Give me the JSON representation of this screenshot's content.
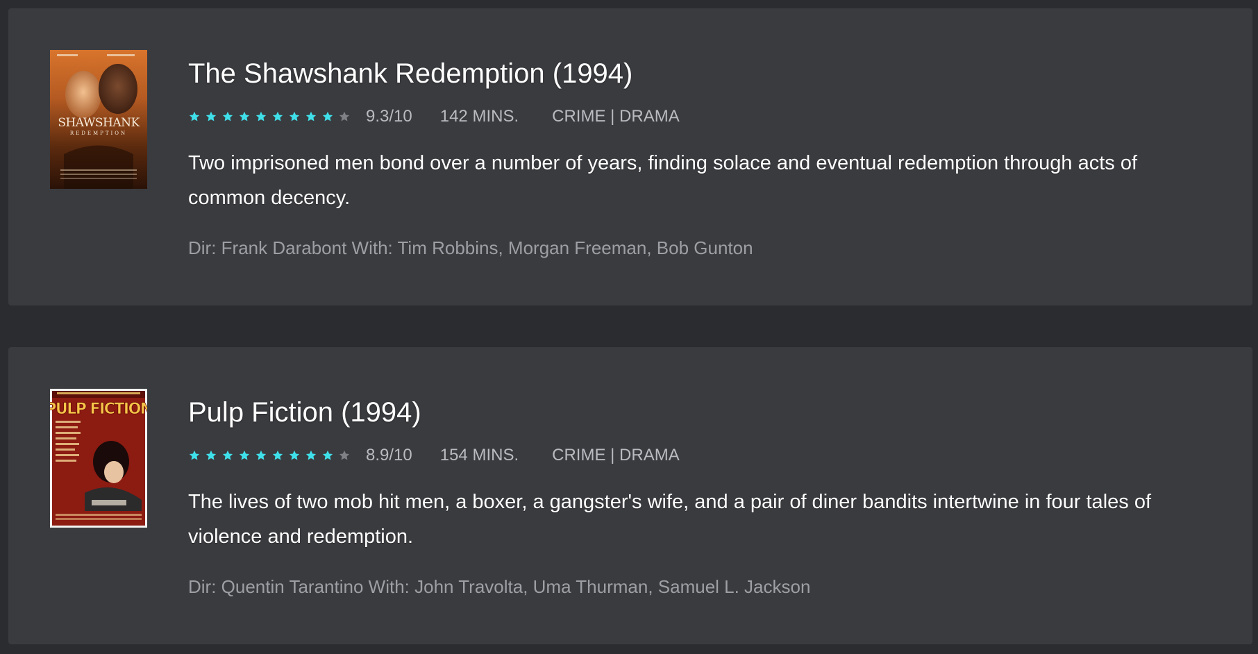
{
  "colors": {
    "background": "#2b2c30",
    "card": "#3a3b3f",
    "star_filled": "#3fe0ea",
    "star_empty": "#7f8186",
    "muted_text": "#b9bbc0"
  },
  "movies": [
    {
      "title": "The Shawshank Redemption (1994)",
      "rating_value": 9.3,
      "rating": "9.3/10",
      "stars_filled": 9,
      "stars_total": 10,
      "runtime": "142 MINS.",
      "genres": "CRIME | DRAMA",
      "plot": "Two imprisoned men bond over a number of years, finding solace and eventual redemption through acts of common decency.",
      "credits": "Dir: Frank Darabont With: Tim Robbins, Morgan Freeman, Bob Gunton",
      "poster": {
        "text": "SHAWSHANK",
        "subtext": "REDEMPTION"
      }
    },
    {
      "title": "Pulp Fiction (1994)",
      "rating_value": 8.9,
      "rating": "8.9/10",
      "stars_filled": 9,
      "stars_total": 10,
      "runtime": "154 MINS.",
      "genres": "CRIME | DRAMA",
      "plot": "The lives of two mob hit men, a boxer, a gangster's wife, and a pair of diner bandits intertwine in four tales of violence and redemption.",
      "credits": "Dir: Quentin Tarantino With: John Travolta, Uma Thurman, Samuel L. Jackson",
      "poster": {
        "text": "PULP FICTION"
      }
    }
  ]
}
